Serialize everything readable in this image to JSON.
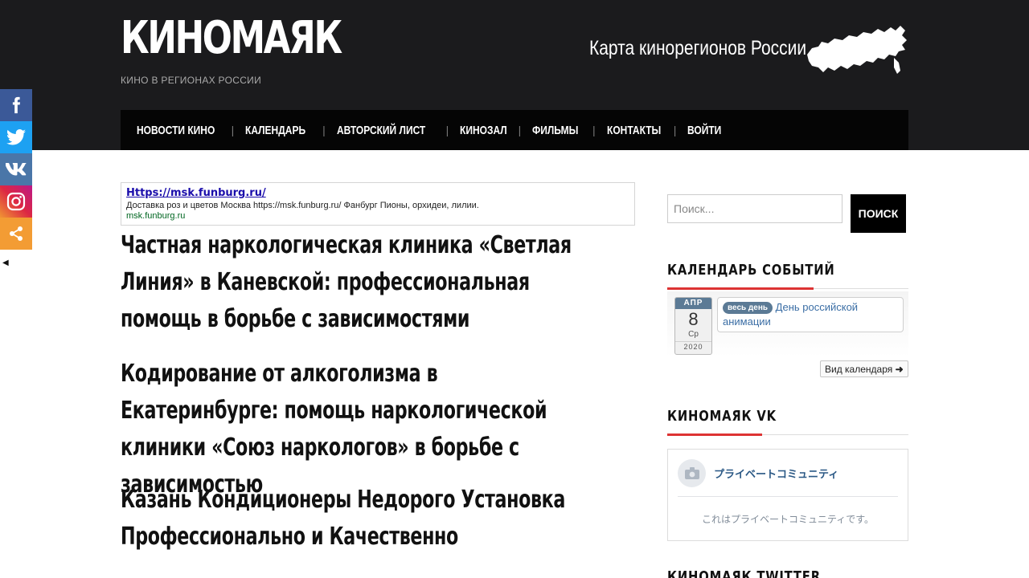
{
  "site": {
    "logo": "КИНОМАЯК",
    "tagline": "КИНО В РЕГИОНАХ РОССИИ",
    "map_link": "Карта кинорегионов России",
    "map_icon": "russia-map-icon"
  },
  "nav": {
    "items": [
      {
        "label": "НОВОСТИ КИНО"
      },
      {
        "label": "КАЛЕНДАРЬ"
      },
      {
        "label": "АВТОРСКИЙ ЛИСТ"
      },
      {
        "label": "КИНОЗАЛ"
      },
      {
        "label": "ФИЛЬМЫ"
      },
      {
        "label": "КОНТАКТЫ"
      },
      {
        "label": "ВОЙТИ"
      }
    ],
    "separator": "|"
  },
  "social": {
    "buttons": [
      {
        "icon": "facebook-icon",
        "color": "#3b5998"
      },
      {
        "icon": "twitter-icon",
        "color": "#1da1f2"
      },
      {
        "icon": "vk-icon",
        "color": "#4a76a8"
      },
      {
        "icon": "instagram-icon",
        "color": "#c13584"
      },
      {
        "icon": "share-icon",
        "color": "#f39c34"
      }
    ],
    "hide_icon": "chevron-left-icon"
  },
  "ad": {
    "title": "Https://msk.funburg.ru/",
    "description": "Доставка роз и цветов Москва https://msk.funburg.ru/ Фанбург Пионы, орхидеи, лилии.",
    "url": "msk.funburg.ru"
  },
  "posts": [
    {
      "title": "Частная наркологическая клиника «Светлая Линия» в Каневской: профессиональная помощь в борьбе с зависимостями"
    },
    {
      "title": "Кодирование от алкоголизма в Екатеринбурге: помощь наркологической клиники «Союз наркологов» в борьбе с зависимостью"
    },
    {
      "title": "Казань Кондиционеры Недорого Установка Профессионально и Качественно"
    }
  ],
  "sidebar": {
    "search": {
      "placeholder": "Поиск...",
      "button": "ПОИСК"
    },
    "calendar": {
      "title": "КАЛЕНДАРЬ СОБЫТИЙ",
      "date": {
        "month": "АПР",
        "day": "8",
        "weekday": "Ср",
        "year": "2020"
      },
      "event": {
        "badge": "весь день",
        "title": "День российской анимации"
      },
      "view_button": "Вид календаря"
    },
    "vk": {
      "title": "КИНОМАЯК VK",
      "community_name": "プライベートコミュニティ",
      "note": "これはプライベートコミュニティです。"
    },
    "twitter": {
      "title": "КИНОМАЯК TWITTER"
    }
  },
  "colors": {
    "header_bg": "#1b1b1d",
    "nav_bg": "#050505",
    "accent_red": "#dd3333",
    "event_blue": "#5b7a95"
  }
}
